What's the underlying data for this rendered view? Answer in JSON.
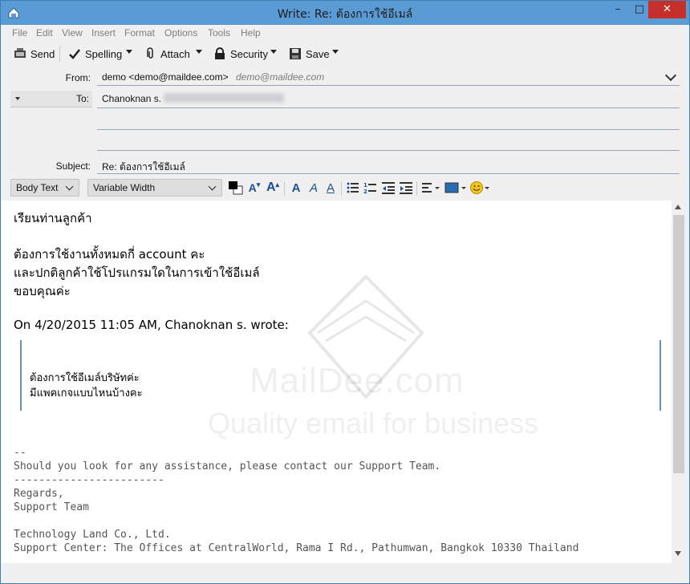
{
  "window": {
    "title": "Write: Re: ต้องการใช้อีเมล์",
    "close_glyph": "✕",
    "max_glyph": "□",
    "min_glyph": "–"
  },
  "menu": {
    "items": [
      "File",
      "Edit",
      "View",
      "Insert",
      "Format",
      "Options",
      "Tools",
      "Help"
    ]
  },
  "toolbar": {
    "send": "Send",
    "spelling": "Spelling",
    "attach": "Attach",
    "security": "Security",
    "save": "Save"
  },
  "headers": {
    "from_label": "From:",
    "from_value": "demo <demo@maildee.com>",
    "from_identity": "demo@maildee.com",
    "to_label": "To:",
    "to_value": "Chanoknan s.",
    "subject_label": "Subject:",
    "subject_value": "Re: ต้องการใช้อีเมล์"
  },
  "format": {
    "paragraph_style": "Body Text",
    "font": "Variable Width"
  },
  "message": {
    "greeting": "เรียนท่านลูกค้า",
    "line1": "ต้องการใช้งานทั้งหมดกี่ account คะ",
    "line2": "และปกติลูกค้าใช้โปรแกรมใดในการเข้าใช้อีเมล์",
    "line3": "ขอบคุณค่ะ",
    "quote_header": "On 4/20/2015 11:05 AM, Chanoknan s. wrote:",
    "quote_line1": "ต้องการใช้อีเมล์บริษัทค่ะ",
    "quote_line2": "มีแพคเกจแบบไหนบ้างคะ"
  },
  "signature": {
    "dashes": "--",
    "assist": "Should you look for any assistance, please contact our Support Team.",
    "rule": "------------------------",
    "regards": "Regards,",
    "team": "Support Team",
    "company": "Technology Land Co., Ltd.",
    "center": "Support Center: The Offices at CentralWorld, Rama I Rd., Pathumwan, Bangkok 10330 Thailand"
  },
  "watermark": {
    "brand": "MailDee.com",
    "tagline": "Quality email for business"
  },
  "colors": {
    "titlebar": "#5b9bd5",
    "close": "#c7302a",
    "accent": "#1f4f92"
  }
}
